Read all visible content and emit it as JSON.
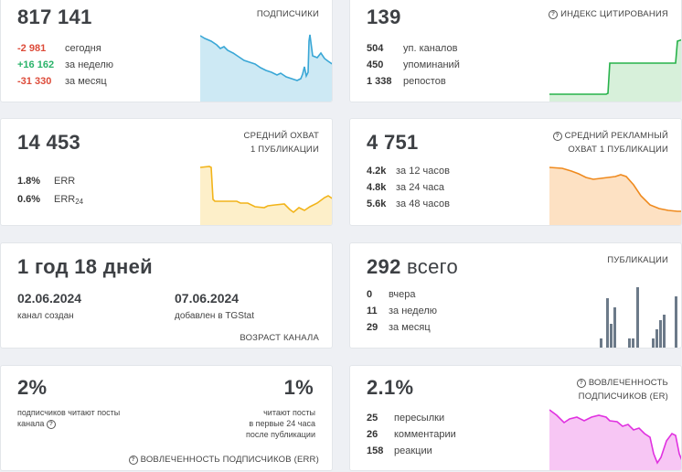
{
  "subscribers": {
    "value": "817 141",
    "label": "ПОДПИСЧИКИ",
    "rows": [
      {
        "num": "-2 981",
        "desc": "сегодня"
      },
      {
        "num": "+16 162",
        "desc": "за неделю"
      },
      {
        "num": "-31 330",
        "desc": "за месяц"
      }
    ]
  },
  "citation": {
    "value": "139",
    "label": "ИНДЕКС ЦИТИРОВАНИЯ",
    "rows": [
      {
        "num": "504",
        "desc": "уп. каналов"
      },
      {
        "num": "450",
        "desc": "упоминаний"
      },
      {
        "num": "1 338",
        "desc": "репостов"
      }
    ]
  },
  "avg_reach": {
    "value": "14 453",
    "label_line1": "СРЕДНИЙ ОХВАТ",
    "label_line2": "1 ПУБЛИКАЦИИ",
    "rows": [
      {
        "num": "1.8%",
        "desc": "ERR"
      },
      {
        "num": "0.6%",
        "desc": "ERR",
        "sub": "24"
      }
    ]
  },
  "ad_reach": {
    "value": "4 751",
    "label_line1": "СРЕДНИЙ РЕКЛАМНЫЙ",
    "label_line2": "ОХВАТ 1 ПУБЛИКАЦИИ",
    "rows": [
      {
        "num": "4.2k",
        "desc": "за 12 часов"
      },
      {
        "num": "4.8k",
        "desc": "за 24 часа"
      },
      {
        "num": "5.6k",
        "desc": "за 48 часов"
      }
    ]
  },
  "age": {
    "value": "1 год 18 дней",
    "created_date": "02.06.2024",
    "created_label": "канал создан",
    "added_date": "07.06.2024",
    "added_label": "добавлен в TGStat",
    "label": "ВОЗРАСТ КАНАЛА"
  },
  "publications": {
    "value": "292",
    "value_suffix": "всего",
    "label": "ПУБЛИКАЦИИ",
    "rows": [
      {
        "num": "0",
        "desc": "вчера"
      },
      {
        "num": "11",
        "desc": "за неделю"
      },
      {
        "num": "29",
        "desc": "за месяц"
      }
    ]
  },
  "err": {
    "left_value": "2%",
    "left_text_line1": "подписчиков читают посты",
    "left_text_line2": "канала",
    "right_value": "1%",
    "right_text_line1": "читают посты",
    "right_text_line2": "в первые 24 часа",
    "right_text_line3": "после публикации",
    "label": "ВОВЛЕЧЕННОСТЬ ПОДПИСЧИКОВ (ERR)"
  },
  "engagement": {
    "value": "2.1%",
    "label_line1": "ВОВЛЕЧЕННОСТЬ",
    "label_line2": "ПОДПИСЧИКОВ (ER)",
    "rows": [
      {
        "num": "25",
        "desc": "пересылки"
      },
      {
        "num": "26",
        "desc": "комментарии"
      },
      {
        "num": "158",
        "desc": "реакции"
      }
    ]
  },
  "colors": {
    "blue": "#3aa7d6",
    "green": "#27b24a",
    "yellow": "#f2b41a",
    "orange": "#ef8a1e",
    "gray": "#6c7a89",
    "magenta": "#e031e0",
    "negative": "#dd4b39",
    "positive": "#2ab36a"
  },
  "icons": {
    "question": "question-circle-icon"
  }
}
